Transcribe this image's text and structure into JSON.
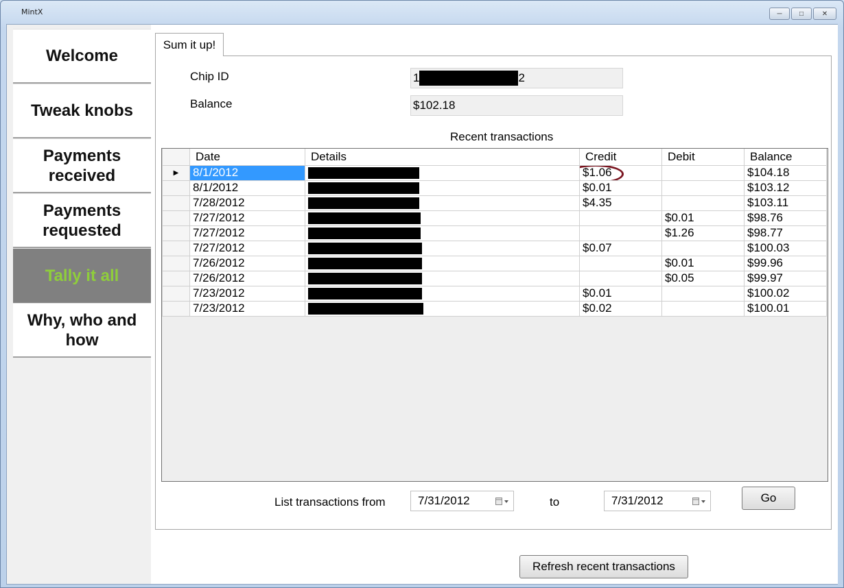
{
  "window": {
    "title": "MintX"
  },
  "nav": {
    "items": [
      {
        "label": "Welcome",
        "active": false
      },
      {
        "label": "Tweak knobs",
        "active": false
      },
      {
        "label": "Payments received",
        "active": false
      },
      {
        "label": "Payments requested",
        "active": false
      },
      {
        "label": "Tally it all",
        "active": true
      },
      {
        "label": "Why, who and how",
        "active": false
      }
    ]
  },
  "tab": {
    "label": "Sum it up!"
  },
  "fields": {
    "chip_id_label": "Chip ID",
    "chip_id_prefix": "1",
    "chip_id_suffix": "2",
    "balance_label": "Balance",
    "balance_value": "$102.18"
  },
  "grid": {
    "title": "Recent transactions",
    "columns": [
      "Date",
      "Details",
      "Credit",
      "Debit",
      "Balance"
    ],
    "rows": [
      {
        "date": "8/1/2012",
        "credit": "$1.06",
        "debit": "",
        "balance": "$104.18"
      },
      {
        "date": "8/1/2012",
        "credit": "$0.01",
        "debit": "",
        "balance": "$103.12"
      },
      {
        "date": "7/28/2012",
        "credit": "$4.35",
        "debit": "",
        "balance": "$103.11"
      },
      {
        "date": "7/27/2012",
        "credit": "",
        "debit": "$0.01",
        "balance": "$98.76"
      },
      {
        "date": "7/27/2012",
        "credit": "",
        "debit": "$1.26",
        "balance": "$98.77"
      },
      {
        "date": "7/27/2012",
        "credit": "$0.07",
        "debit": "",
        "balance": "$100.03"
      },
      {
        "date": "7/26/2012",
        "credit": "",
        "debit": "$0.01",
        "balance": "$99.96"
      },
      {
        "date": "7/26/2012",
        "credit": "",
        "debit": "$0.05",
        "balance": "$99.97"
      },
      {
        "date": "7/23/2012",
        "credit": "$0.01",
        "debit": "",
        "balance": "$100.02"
      },
      {
        "date": "7/23/2012",
        "credit": "$0.02",
        "debit": "",
        "balance": "$100.01"
      }
    ]
  },
  "filter": {
    "from_label": "List transactions from",
    "from_value": "7/31/2012",
    "to_label": "to",
    "to_value": "7/31/2012",
    "go_label": "Go"
  },
  "refresh_label": "Refresh recent transactions",
  "colors": {
    "selected_row": "#3399ff",
    "active_nav_bg": "#808080",
    "active_nav_text": "#8fce3b",
    "annotation_circle": "#7a1520"
  }
}
